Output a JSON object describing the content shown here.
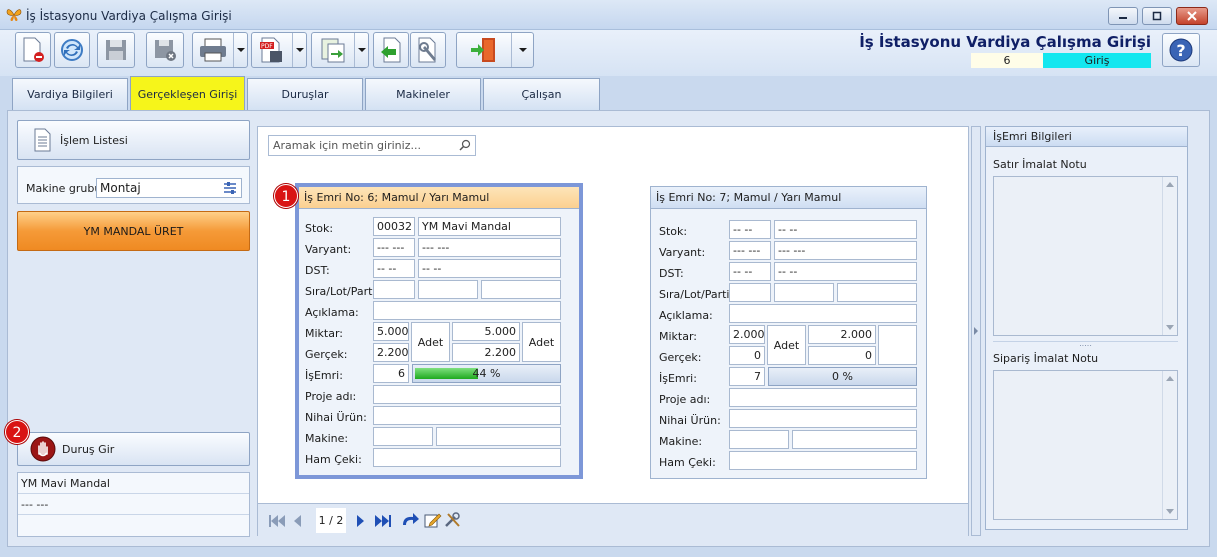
{
  "window": {
    "title": "İş İstasyonu Vardiya Çalışma Girişi",
    "controls": [
      "minimize-icon",
      "maximize-icon",
      "close-icon"
    ]
  },
  "toolbar": {
    "icons": [
      "new-document-icon",
      "refresh-icon",
      "save-icon",
      "save-close-icon",
      "print-icon",
      "pdf-export-icon",
      "export-icon",
      "back-icon",
      "settings-icon",
      "exit-icon"
    ]
  },
  "header": {
    "title": "İş İstasyonu Vardiya Çalışma Girişi",
    "number": "6",
    "status": "Giriş",
    "status_color": "#14e7ef"
  },
  "tabs": [
    "Vardiya Bilgileri",
    "Gerçekleşen Girişi",
    "Duruşlar",
    "Makineler",
    "Çalışan"
  ],
  "active_tab": "Gerçekleşen Girişi",
  "left": {
    "operation_list": "İşlem Listesi",
    "machine_group_label": "Makine grubu",
    "machine_group_value": "Montaj",
    "produce_button": "YM MANDAL ÜRET",
    "stop_button": "Duruş Gir",
    "info": [
      "YM Mavi Mandal",
      "--- ---",
      ""
    ]
  },
  "search": {
    "placeholder": "Aramak için metin giriniz..."
  },
  "labels": {
    "stok": "Stok:",
    "varyant": "Varyant:",
    "dst": "DST:",
    "sira": "Sıra/Lot/Parti:",
    "aciklama": "Açıklama:",
    "miktar": "Miktar:",
    "gercek": "Gerçek:",
    "isemri": "İşEmri:",
    "proje": "Proje adı:",
    "nihai": "Nihai Ürün:",
    "makine": "Makine:",
    "hamceki": "Ham Çeki:"
  },
  "cards": [
    {
      "title": "İş Emri No: 6; Mamul / Yarı Mamul",
      "stok_code": "00032",
      "stok_name": "YM Mavi Mandal",
      "varyant_code": "--- ---",
      "varyant_name": "--- ---",
      "dst_code": "-- --",
      "dst_name": "-- --",
      "miktar": "5.000",
      "miktar_unit": "Adet",
      "miktar_total": "5.000",
      "total_unit": "Adet",
      "gercek": "2.200",
      "gercek_total": "2.200",
      "isemri": "6",
      "progress_text": "44 %",
      "progress": 0.44
    },
    {
      "title": "İş Emri No: 7; Mamul / Yarı Mamul",
      "stok_code": "-- --",
      "stok_name": "-- --",
      "varyant_code": "--- ---",
      "varyant_name": "--- ---",
      "dst_code": "-- --",
      "dst_name": "-- --",
      "miktar": "2.000",
      "miktar_unit": "Adet",
      "miktar_total": "2.000",
      "total_unit": "",
      "gercek": "0",
      "gercek_total": "0",
      "isemri": "7",
      "progress_text": "0 %",
      "progress": 0
    }
  ],
  "badges": [
    "1",
    "2"
  ],
  "pager": {
    "page_text": "1 / 2"
  },
  "right": {
    "title": "İşEmri Bilgileri",
    "satir_label": "Satır İmalat Notu",
    "siparis_label": "Sipariş İmalat Notu",
    "splitter": "....."
  }
}
